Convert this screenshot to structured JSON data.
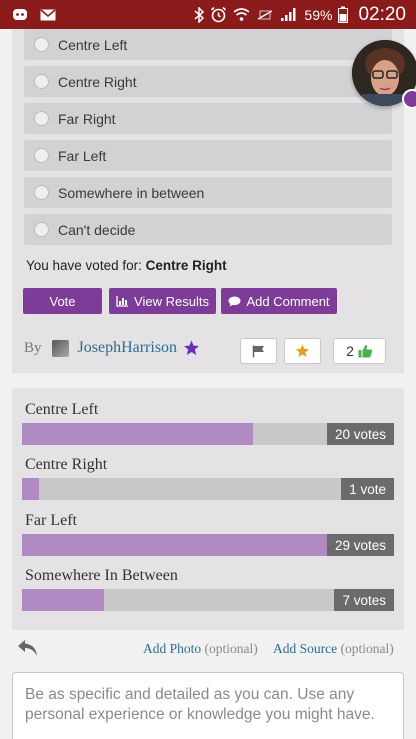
{
  "status_bar": {
    "battery_percent": "59%",
    "time": "02:20",
    "icons": [
      "discord-icon",
      "gmail-icon",
      "bluetooth-icon",
      "alarm-icon",
      "wifi-icon",
      "no-sim-icon",
      "signal-icon",
      "battery-icon"
    ]
  },
  "poll": {
    "options": [
      {
        "label": "Centre Left"
      },
      {
        "label": "Centre Right"
      },
      {
        "label": "Far Right"
      },
      {
        "label": "Far Left"
      },
      {
        "label": "Somewhere in between"
      },
      {
        "label": "Can't decide"
      }
    ],
    "voted_prefix": "You have voted for: ",
    "voted_choice": "Centre Right",
    "vote_button": "Vote",
    "view_results_button": "View Results",
    "add_comment_button": "Add Comment"
  },
  "byline": {
    "by": "By",
    "author": "JosephHarrison",
    "like_count": "2"
  },
  "results": [
    {
      "label": "Centre Left",
      "votes": "20 votes",
      "fraction": 0.62
    },
    {
      "label": "Centre Right",
      "votes": "1 vote",
      "fraction": 0.045
    },
    {
      "label": "Far Left",
      "votes": "29 votes",
      "fraction": 0.88
    },
    {
      "label": "Somewhere In Between",
      "votes": "7 votes",
      "fraction": 0.22
    }
  ],
  "compose": {
    "add_photo": "Add Photo",
    "add_source": "Add Source",
    "optional": "(optional)",
    "placeholder": "Be as specific and detailed as you can. Use any personal experience or knowledge you might have."
  },
  "colors": {
    "status_bar": "#8b1a1a",
    "accent": "#7d3c98",
    "bar_fill": "#b08ac3",
    "link": "#2a6e8e"
  }
}
